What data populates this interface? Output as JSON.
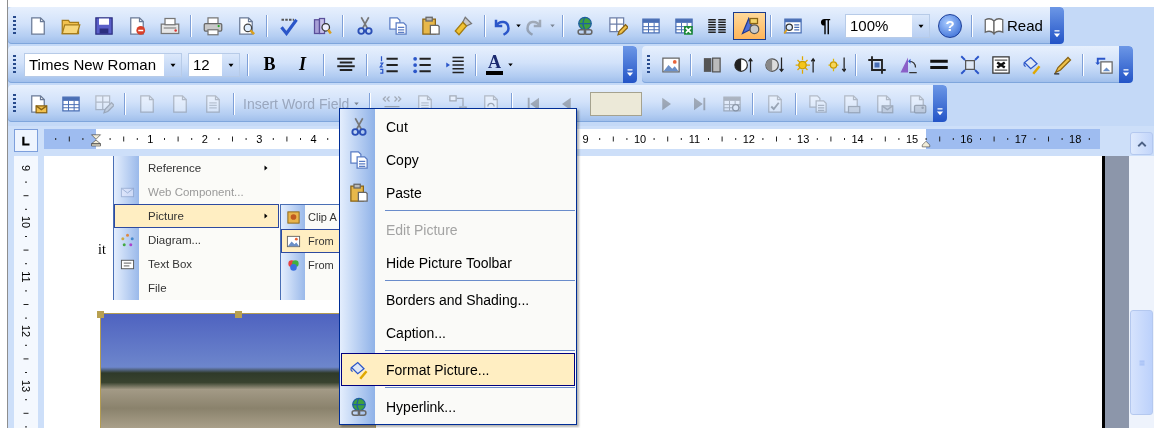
{
  "standard_toolbar": {
    "items": [
      {
        "kind": "icon",
        "on": false,
        "disabled": false
      },
      {
        "kind": "icon",
        "on": false,
        "disabled": false
      },
      {
        "kind": "icon",
        "on": false,
        "disabled": false
      },
      {
        "kind": "icon",
        "on": false,
        "disabled": false
      },
      {
        "kind": "icon",
        "on": false,
        "disabled": false
      },
      {
        "kind": "separator"
      },
      {
        "kind": "icon",
        "on": false,
        "disabled": false
      },
      {
        "kind": "icon",
        "on": false,
        "disabled": false
      },
      {
        "kind": "separator"
      },
      {
        "kind": "icon",
        "on": false,
        "disabled": false
      },
      {
        "kind": "icon",
        "on": false,
        "disabled": false
      },
      {
        "kind": "separator"
      },
      {
        "kind": "icon",
        "on": false,
        "disabled": false
      },
      {
        "kind": "icon",
        "on": false,
        "disabled": false
      },
      {
        "kind": "icon",
        "on": false,
        "disabled": false
      },
      {
        "kind": "icon",
        "on": false,
        "disabled": false
      },
      {
        "kind": "separator"
      },
      {
        "kind": "split",
        "on": false,
        "disabled": false
      },
      {
        "kind": "split",
        "on": false,
        "disabled": true
      },
      {
        "kind": "separator"
      },
      {
        "kind": "icon",
        "on": false,
        "disabled": false
      },
      {
        "kind": "icon",
        "on": false,
        "disabled": false
      },
      {
        "kind": "icon",
        "on": false,
        "disabled": false
      },
      {
        "kind": "icon",
        "on": false,
        "disabled": false
      },
      {
        "kind": "icon",
        "on": false,
        "disabled": false
      },
      {
        "kind": "icon",
        "on": true,
        "disabled": false
      },
      {
        "kind": "separator"
      },
      {
        "kind": "icon",
        "on": false,
        "disabled": false
      },
      {
        "kind": "glyph",
        "label": "¶",
        "on": false,
        "disabled": false
      },
      {
        "kind": "combo",
        "value": "100%"
      },
      {
        "kind": "help",
        "label": "?",
        "on": false,
        "disabled": false
      },
      {
        "kind": "separator"
      },
      {
        "kind": "labeled",
        "label": "Read",
        "on": false,
        "disabled": false
      }
    ]
  },
  "formatting_toolbar": {
    "items": [
      {
        "kind": "combo",
        "value": "Times New Roman"
      },
      {
        "kind": "combo",
        "value": "12"
      },
      {
        "kind": "separator"
      },
      {
        "kind": "glyph",
        "label": "B",
        "disabled": false
      },
      {
        "kind": "glyph",
        "label": "I",
        "disabled": false
      },
      {
        "kind": "separator"
      },
      {
        "kind": "icon",
        "disabled": false
      },
      {
        "kind": "separator"
      },
      {
        "kind": "icon",
        "disabled": false
      },
      {
        "kind": "icon",
        "disabled": false
      },
      {
        "kind": "icon",
        "disabled": false
      },
      {
        "kind": "separator"
      },
      {
        "kind": "color",
        "label": "A",
        "disabled": false
      }
    ]
  },
  "picture_toolbar": {
    "items": [
      {
        "kind": "icon",
        "disabled": false
      },
      {
        "kind": "separator"
      },
      {
        "kind": "icon",
        "disabled": false
      },
      {
        "kind": "icon",
        "disabled": false
      },
      {
        "kind": "icon",
        "disabled": false
      },
      {
        "kind": "icon",
        "disabled": false
      },
      {
        "kind": "icon",
        "disabled": false
      },
      {
        "kind": "separator"
      },
      {
        "kind": "icon",
        "disabled": false
      },
      {
        "kind": "icon",
        "disabled": false
      },
      {
        "kind": "icon",
        "disabled": false
      },
      {
        "kind": "icon",
        "disabled": false
      },
      {
        "kind": "icon",
        "disabled": false
      },
      {
        "kind": "icon",
        "disabled": false
      },
      {
        "kind": "icon",
        "disabled": false
      },
      {
        "kind": "separator"
      },
      {
        "kind": "icon",
        "disabled": false
      }
    ]
  },
  "mail_merge_toolbar": {
    "items": [
      {
        "kind": "icon",
        "disabled": false
      },
      {
        "kind": "icon",
        "disabled": false
      },
      {
        "kind": "icon",
        "disabled": true
      },
      {
        "kind": "separator"
      },
      {
        "kind": "icon",
        "disabled": true
      },
      {
        "kind": "icon",
        "disabled": true
      },
      {
        "kind": "icon",
        "disabled": true
      },
      {
        "kind": "separator"
      },
      {
        "kind": "dropdown",
        "label": "Insert Word Field",
        "disabled": true
      },
      {
        "kind": "separator"
      },
      {
        "kind": "icon",
        "disabled": true
      },
      {
        "kind": "icon",
        "disabled": true
      },
      {
        "kind": "icon",
        "disabled": true
      },
      {
        "kind": "icon",
        "disabled": true
      },
      {
        "kind": "separator"
      },
      {
        "kind": "icon",
        "disabled": true
      },
      {
        "kind": "icon",
        "disabled": true
      },
      {
        "kind": "field",
        "disabled": true
      },
      {
        "kind": "icon",
        "disabled": true
      },
      {
        "kind": "icon",
        "disabled": true
      },
      {
        "kind": "icon",
        "disabled": true
      },
      {
        "kind": "separator"
      },
      {
        "kind": "icon",
        "disabled": true
      },
      {
        "kind": "separator"
      },
      {
        "kind": "icon",
        "disabled": true
      },
      {
        "kind": "icon",
        "disabled": true
      },
      {
        "kind": "icon",
        "disabled": true
      },
      {
        "kind": "icon",
        "disabled": true
      }
    ]
  },
  "horizontal_ruler": {
    "labels_left_of_menu": [
      "1",
      "2",
      "3",
      "4"
    ],
    "labels_right_of_menu": [
      "9",
      "10",
      "11",
      "12",
      "13",
      "14",
      "15",
      "16",
      "17",
      "18"
    ]
  },
  "vertical_ruler": {
    "labels": [
      "9",
      "10",
      "11",
      "12",
      "13"
    ]
  },
  "document": {
    "text_fragment": "it",
    "embedded_screenshot": {
      "menu": [
        {
          "label": "Reference",
          "has_submenu": true,
          "disabled": false,
          "selected": false
        },
        {
          "label": "Web Component...",
          "has_submenu": false,
          "disabled": true,
          "selected": false
        },
        {
          "label": "Picture",
          "has_submenu": true,
          "disabled": false,
          "selected": true
        },
        {
          "label": "Diagram...",
          "has_submenu": false,
          "disabled": false,
          "selected": false
        },
        {
          "label": "Text Box",
          "has_submenu": false,
          "disabled": false,
          "selected": false
        },
        {
          "label": "File",
          "has_submenu": false,
          "disabled": false,
          "selected": false
        }
      ],
      "submenu": [
        {
          "label": "Clip A",
          "selected": false
        },
        {
          "label": "From",
          "selected": true
        },
        {
          "label": "From",
          "selected": false
        }
      ]
    },
    "photo": {
      "selected": true
    }
  },
  "context_menu": {
    "items": [
      {
        "kind": "item",
        "label": "Cut",
        "disabled": false,
        "selected": false
      },
      {
        "kind": "item",
        "label": "Copy",
        "disabled": false,
        "selected": false
      },
      {
        "kind": "item",
        "label": "Paste",
        "disabled": false,
        "selected": false
      },
      {
        "kind": "separator"
      },
      {
        "kind": "item",
        "label": "Edit Picture",
        "disabled": true,
        "selected": false
      },
      {
        "kind": "item",
        "label": "Hide Picture Toolbar",
        "disabled": false,
        "selected": false
      },
      {
        "kind": "separator"
      },
      {
        "kind": "item",
        "label": "Borders and Shading...",
        "disabled": false,
        "selected": false
      },
      {
        "kind": "item",
        "label": "Caption...",
        "disabled": false,
        "selected": false
      },
      {
        "kind": "separator"
      },
      {
        "kind": "item",
        "label": "Format Picture...",
        "disabled": false,
        "selected": true
      },
      {
        "kind": "separator"
      },
      {
        "kind": "item",
        "label": "Hyperlink...",
        "disabled": false,
        "selected": false
      }
    ]
  }
}
